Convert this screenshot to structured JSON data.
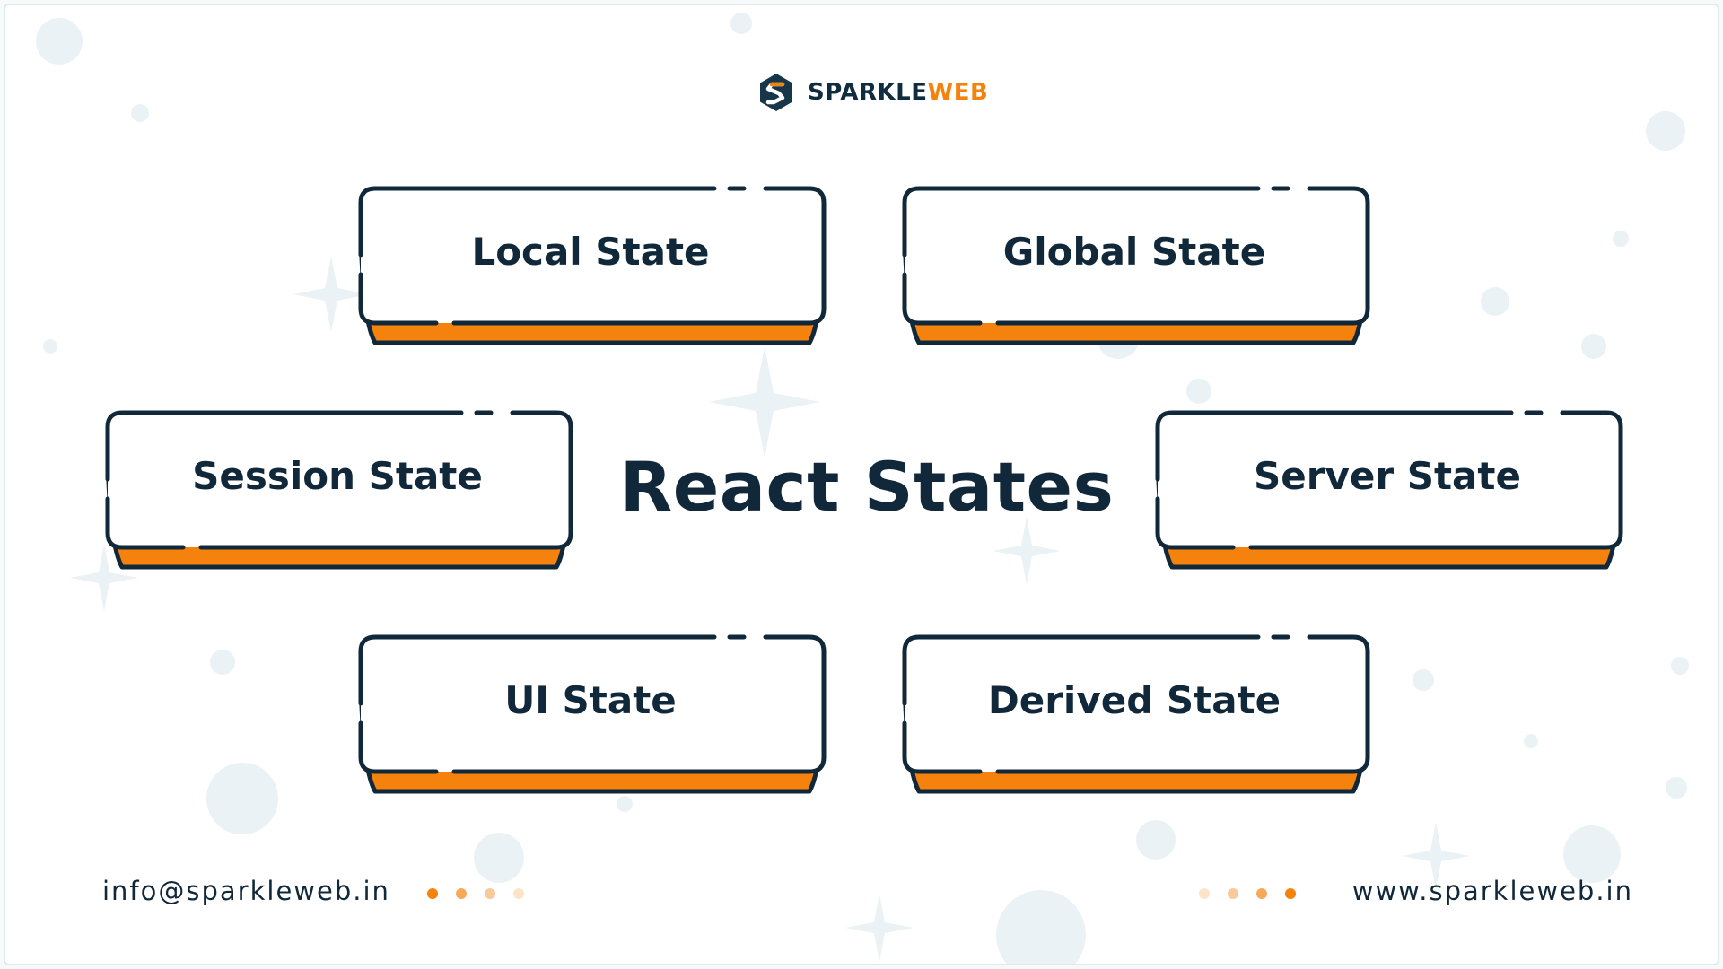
{
  "logo": {
    "icon": "sparkleweb-hexagon-s-icon",
    "word1": "SPARKLE",
    "word2": "WEB"
  },
  "title": "React States",
  "cards": [
    {
      "label": "Local State"
    },
    {
      "label": "Global State"
    },
    {
      "label": "Session State"
    },
    {
      "label": "Server State"
    },
    {
      "label": "UI State"
    },
    {
      "label": "Derived State"
    }
  ],
  "footer": {
    "email": "info@sparkleweb.in",
    "website": "www.sparkleweb.in"
  },
  "colors": {
    "navy": "#10283a",
    "orange": "#f5820d",
    "dot_left": [
      "#f5820d",
      "#f7a95a",
      "#fac99a",
      "#fde3c8"
    ],
    "dot_right": [
      "#fde3c8",
      "#fac99a",
      "#f7a95a",
      "#f5820d"
    ]
  }
}
